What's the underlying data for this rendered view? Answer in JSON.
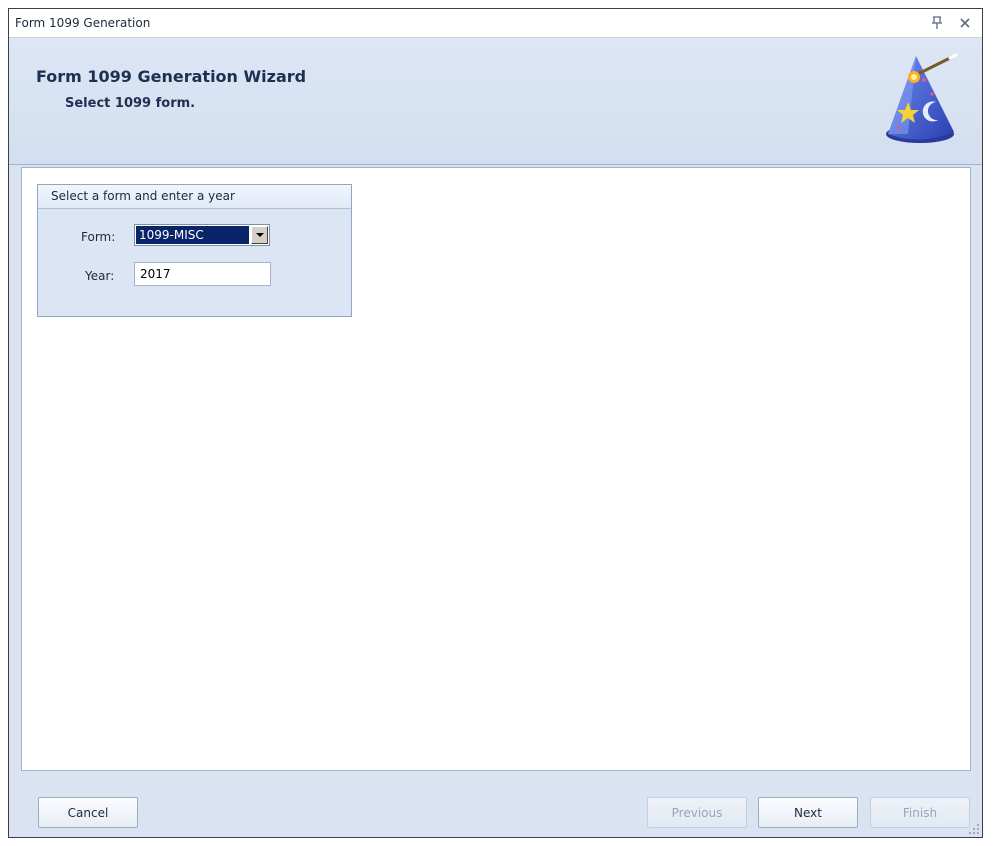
{
  "window": {
    "title": "Form 1099 Generation"
  },
  "header": {
    "title": "Form 1099 Generation Wizard",
    "subtitle": "Select 1099 form."
  },
  "group": {
    "title": "Select a form and enter a year",
    "form_label": "Form:",
    "form_value": "1099-MISC",
    "year_label": "Year:",
    "year_value": "2017"
  },
  "buttons": {
    "cancel": "Cancel",
    "previous": "Previous",
    "next": "Next",
    "finish": "Finish"
  },
  "icons": {
    "pin": "pin-icon",
    "close": "close-icon",
    "wizard": "wizard-hat-icon",
    "grip": "resize-grip-icon"
  },
  "colors": {
    "selection": "#0a246a",
    "header_bg": "#d9e3f2",
    "hat_blue": "#3f5ed6"
  }
}
